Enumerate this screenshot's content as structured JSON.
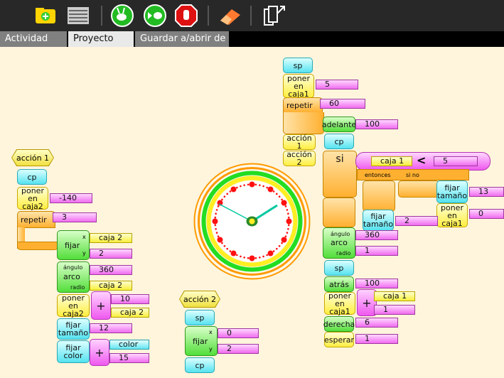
{
  "toolbar": {
    "icons": [
      "activity-icon",
      "projects-list-icon",
      "run-fast-icon",
      "run-step-icon",
      "stop-icon",
      "eraser-icon",
      "share-icon"
    ]
  },
  "tabs": [
    "Actividad",
    "Proyecto",
    "Guardar a/abrir de"
  ],
  "blocks": {
    "cp": "cp",
    "sp": "sp",
    "poner_en_caja2": "poner en caja2",
    "poner_en_caja1": "poner en caja1",
    "repetir": "repetir",
    "fijar": "fijar",
    "angulo": "ángulo",
    "arco": "arco",
    "radio": "radio",
    "x": "x",
    "y": "y",
    "fijar_tamano": "fijar tamaño",
    "fijar_color": "fijar color",
    "plus": "+",
    "accion1": "acción 1",
    "accion2": "acción 2",
    "adelante": "adelante",
    "atras": "atrás",
    "derecha": "derecha",
    "esperar": "esperar",
    "si": "si",
    "entonces": "entonces",
    "si_no": "si no",
    "less": "<"
  },
  "values": {
    "neg140": "-140",
    "three": "3",
    "caja2": "caja 2",
    "two": "2",
    "v360": "360",
    "ten": "10",
    "twelve": "12",
    "color": "color",
    "fifteen": "15",
    "zero": "0",
    "five": "5",
    "sixty": "60",
    "hundred": "100",
    "caja1": "caja 1",
    "thirteen": "13",
    "one": "1",
    "six": "6"
  },
  "colors": {
    "background": "#fef5dc",
    "clock_ring_orange": "#ff9a00",
    "clock_ring_green": "#22dd22",
    "clock_dots": "#ff1010",
    "toolbar": "#282828"
  }
}
